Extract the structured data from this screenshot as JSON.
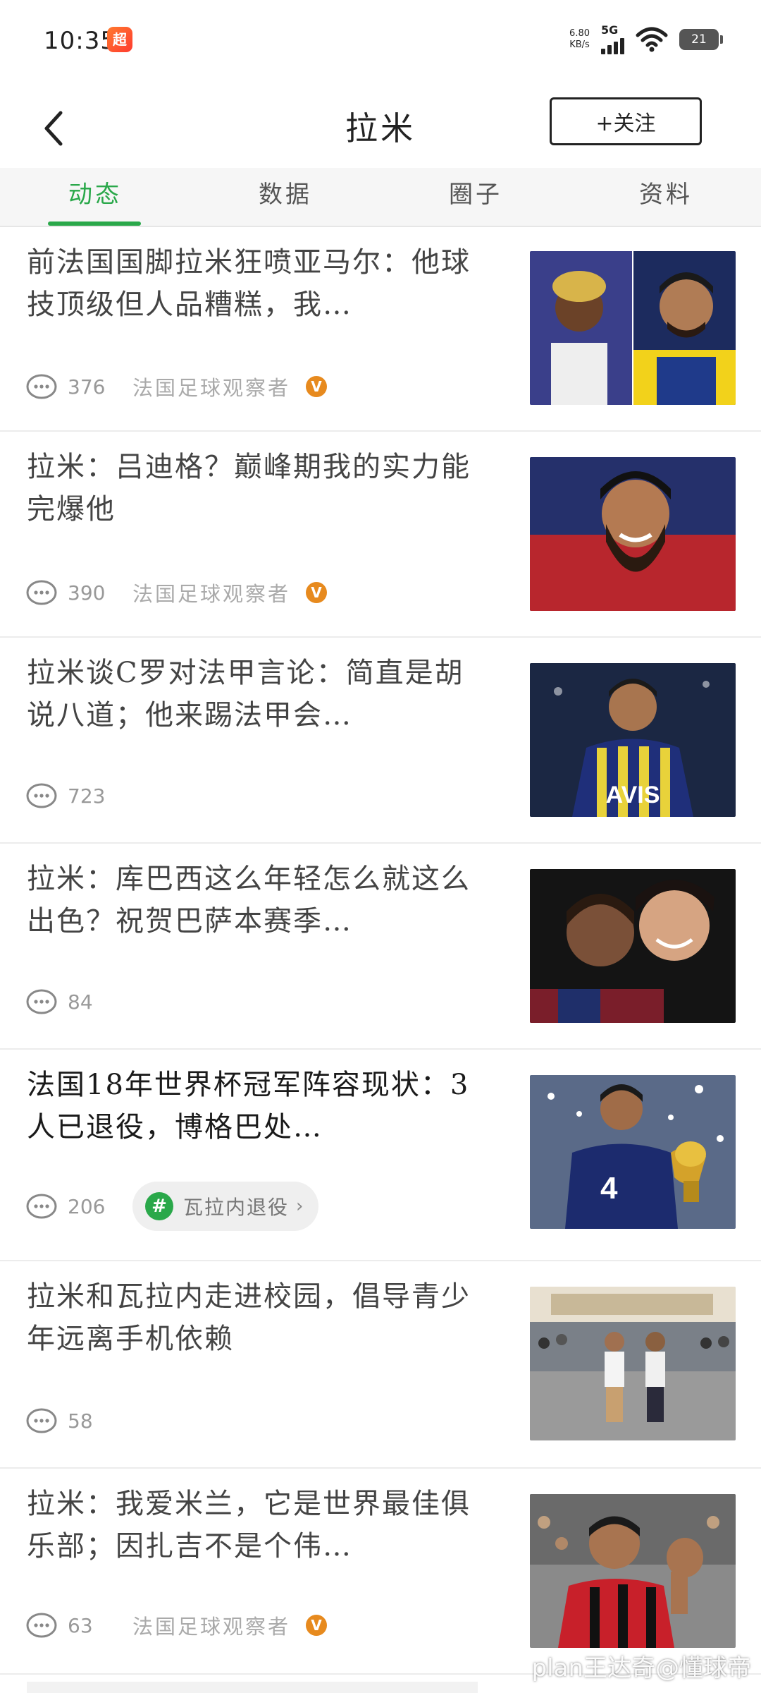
{
  "status_bar": {
    "time": "10:35",
    "app_badge": "超",
    "net_speed_value": "6.80",
    "net_speed_unit": "KB/s",
    "network": "5G",
    "battery": "21"
  },
  "header": {
    "title": "拉米",
    "follow_label": "+关注"
  },
  "tabs": [
    {
      "label": "动态",
      "active": true
    },
    {
      "label": "数据",
      "active": false
    },
    {
      "label": "圈子",
      "active": false
    },
    {
      "label": "资料",
      "active": false
    }
  ],
  "colors": {
    "accent": "#2aa84a",
    "verified_badge": "#e78a1e"
  },
  "items": [
    {
      "title": "前法国国脚拉米狂喷亚马尔：他球技顶级但人品糟糕，我…",
      "comments": "376",
      "source": "法国足球观察者",
      "verified": "V",
      "image": "two-players-portrait"
    },
    {
      "title": "拉米：吕迪格？巅峰期我的实力能完爆他",
      "comments": "390",
      "source": "法国足球观察者",
      "verified": "V",
      "image": "smiling-bearded-man"
    },
    {
      "title": "拉米谈C罗对法甲言论：简直是胡说八道；他来踢法甲会…",
      "comments": "723",
      "image": "player-in-striped-jersey",
      "jersey_text": "AVIS"
    },
    {
      "title": "拉米：库巴西这么年轻怎么就这么出色？祝贺巴萨本赛季…",
      "comments": "84",
      "image": "players-hugging"
    },
    {
      "title": "法国18年世界杯冠军阵容现状：3人已退役，博格巴处…",
      "comments": "206",
      "topic": "瓦拉内退役",
      "topic_hash": "#",
      "image": "player-with-world-cup-trophy"
    },
    {
      "title": "拉米和瓦拉内走进校园，倡导青少年远离手机依赖",
      "comments": "58",
      "image": "school-yard-crowd"
    },
    {
      "title": "拉米：我爱米兰，它是世界最佳俱乐部；因扎吉不是个伟…",
      "comments": "63",
      "source": "法国足球观察者",
      "verified": "V",
      "image": "player-celebrating"
    }
  ],
  "watermark": "plan王达奇@懂球帝"
}
